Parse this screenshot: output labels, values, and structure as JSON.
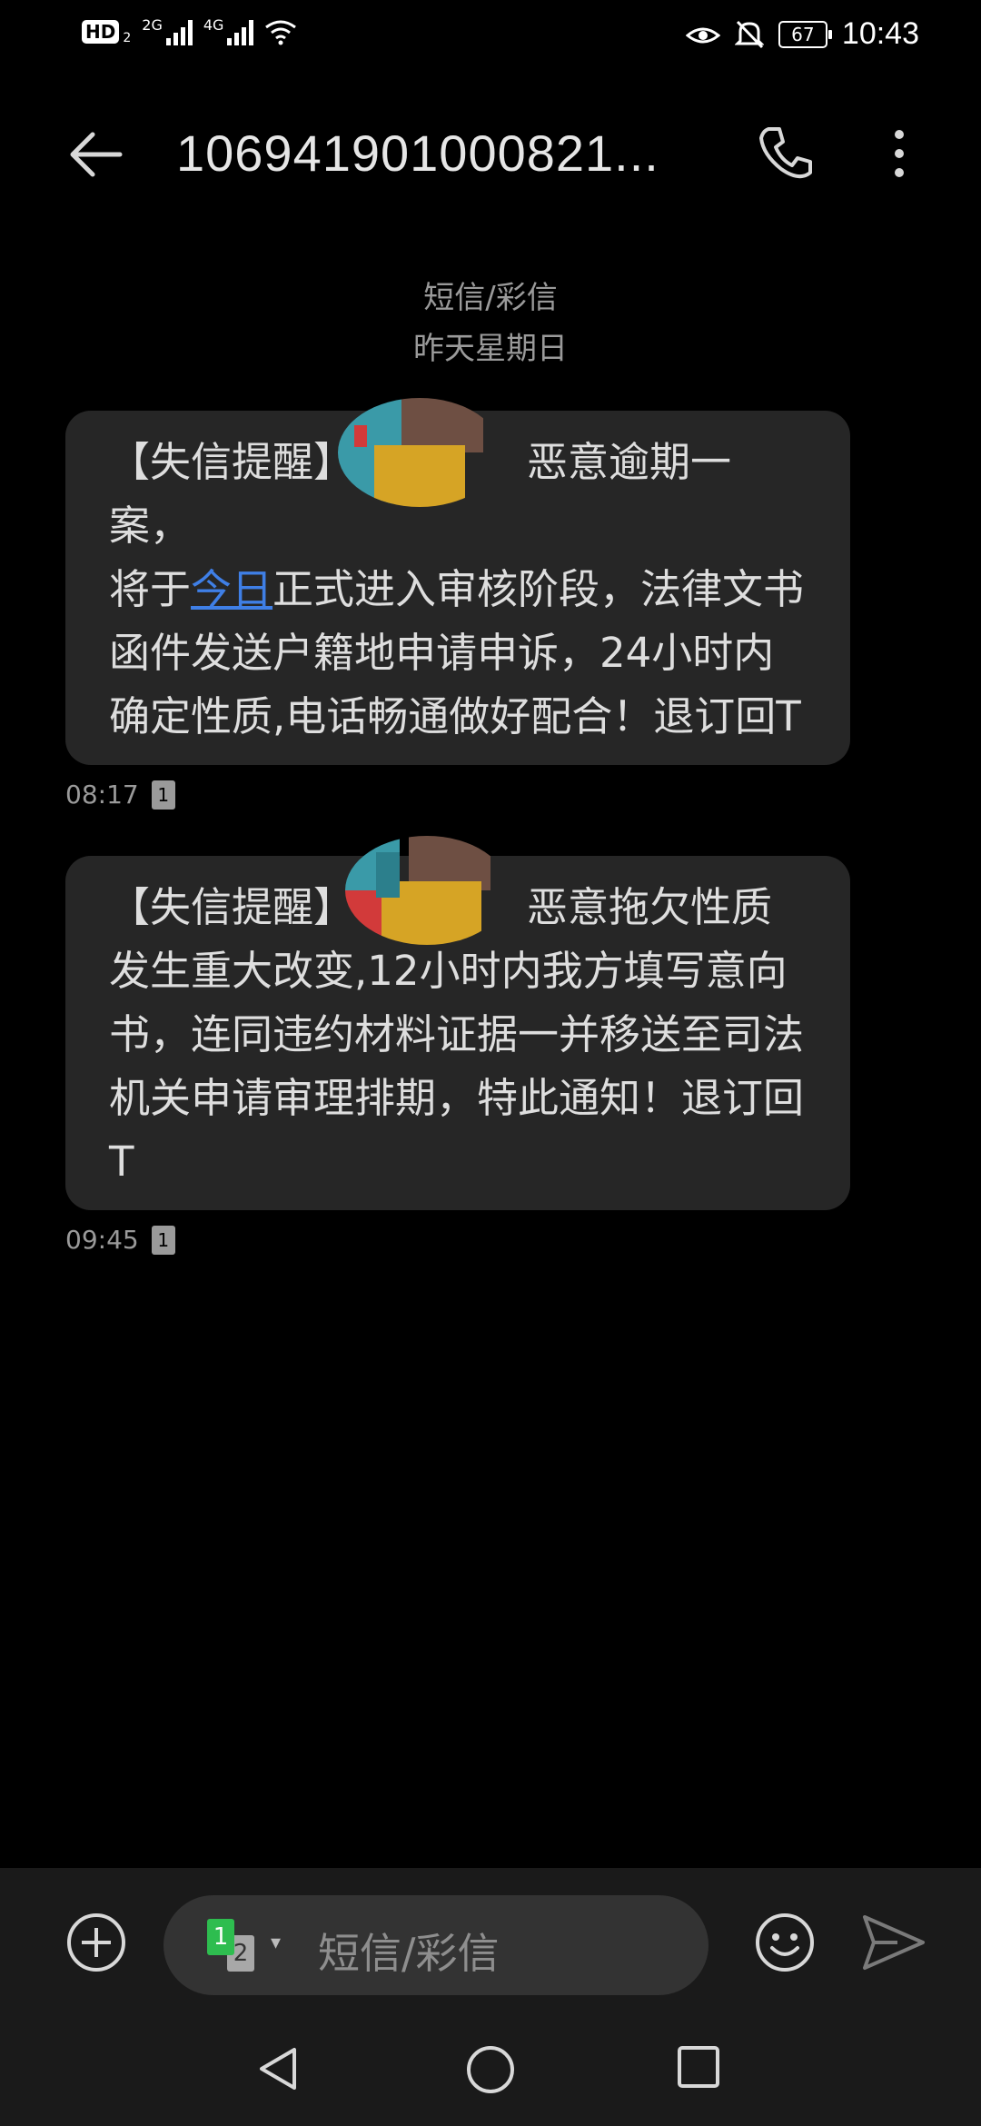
{
  "status_bar": {
    "hd": "HD",
    "hd_sub": "2",
    "net1": "2G",
    "net2": "4G",
    "battery": "67",
    "time": "10:43"
  },
  "header": {
    "contact": "106941901000821..."
  },
  "conversation_meta": {
    "type": "短信/彩信",
    "date": "昨天星期日"
  },
  "messages": [
    {
      "p1": "【失信提醒】",
      "p2": "恶意逾期一案，",
      "p3": "将于",
      "link": "今日",
      "p4": "正式进入审核阶段，法律文书函件发送户籍地申请申诉，24小时内确定性质,电话畅通做好配合！退订回T",
      "time": "08:17",
      "sim": "1"
    },
    {
      "p1": "【失信提醒】",
      "p2": "恶意拖欠性质发生重大改变,12小时内我方填写意向书，连同违约材料证据一并移送至司法机关申请审理排期，特此通知！退订回T",
      "time": "09:45",
      "sim": "1"
    }
  ],
  "compose": {
    "sim1": "1",
    "sim2": "2",
    "placeholder": "短信/彩信"
  },
  "colors": {
    "background": "#000000",
    "bubble": "#262626",
    "link": "#3f7fe6",
    "sim_green": "#2ebd4f"
  }
}
